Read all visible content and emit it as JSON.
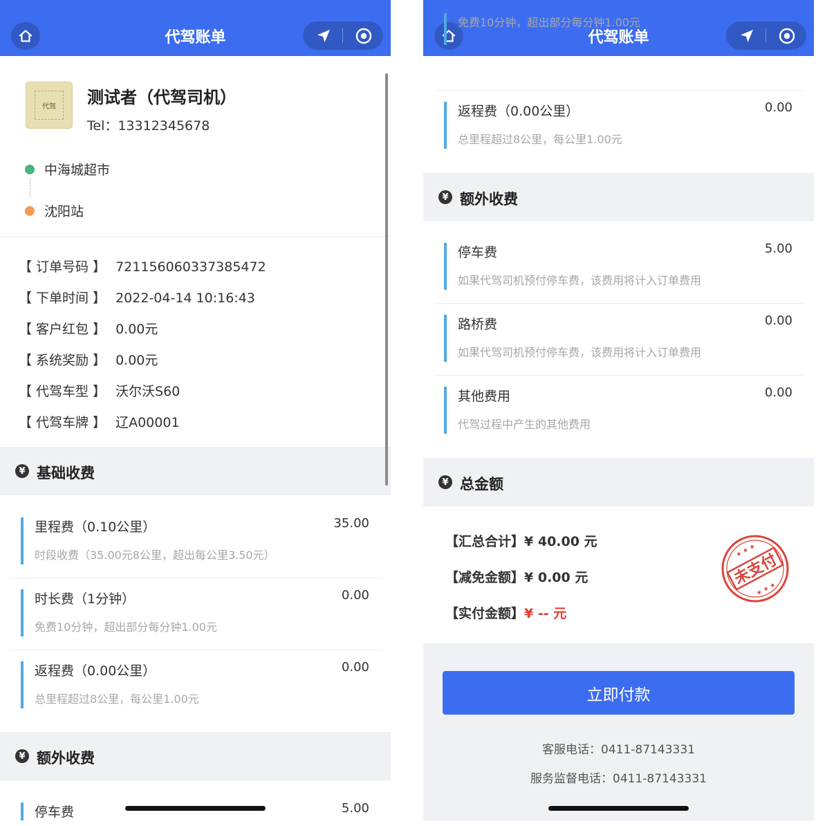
{
  "navbar": {
    "title": "代驾账单"
  },
  "driver": {
    "name": "测试者（代驾司机）",
    "tel": "Tel：13312345678",
    "avatar_text": "代驾",
    "start": "中海城超市",
    "end": "沈阳站",
    "start_color": "#49b47e",
    "end_color": "#f59b52"
  },
  "order": [
    {
      "label": "【 订单号码 】",
      "value": "721156060337385472"
    },
    {
      "label": "【 下单时间 】",
      "value": "2022-04-14 10:16:43"
    },
    {
      "label": "【 客户红包 】",
      "value": "0.00元"
    },
    {
      "label": "【 系统奖励 】",
      "value": "0.00元"
    },
    {
      "label": "【 代驾车型 】",
      "value": "沃尔沃S60"
    },
    {
      "label": "【 代驾车牌 】",
      "value": "辽A00001"
    }
  ],
  "sections": {
    "base": "基础收费",
    "extra": "额外收费",
    "total": "总金额"
  },
  "base_fees": [
    {
      "name": "里程费（0.10公里）",
      "desc": "时段收费（35.00元8公里，超出每公里3.50元）",
      "amount": "35.00"
    },
    {
      "name": "时长费（1分钟）",
      "desc": "免费10分钟，超出部分每分钟1.00元",
      "amount": "0.00"
    },
    {
      "name": "返程费（0.00公里）",
      "desc": "总里程超过8公里，每公里1.00元",
      "amount": "0.00"
    }
  ],
  "extra_fees": [
    {
      "name": "停车费",
      "desc": "如果代驾司机预付停车费，该费用将计入订单费用",
      "amount": "5.00"
    },
    {
      "name": "路桥费",
      "desc": "如果代驾司机预付停车费，该费用将计入订单费用",
      "amount": "0.00"
    },
    {
      "name": "其他费用",
      "desc": "代驾过程中产生的其他费用",
      "amount": "0.00"
    }
  ],
  "summary": {
    "total_label": "【汇总合计】",
    "total_value": "¥ 40.00 元",
    "discount_label": "【减免金额】",
    "discount_value": "¥ 0.00 元",
    "paid_label": "【实付金额】",
    "paid_value": "¥ -- 元",
    "stamp_text": "未支付"
  },
  "pay_button": "立即付款",
  "contact": {
    "service": "客服电话：0411-87143331",
    "supervise": "服务监督电话：0411-87143331"
  },
  "colors": {
    "primary": "#3c6df0",
    "accent_bar": "#51a8e3",
    "paid_red": "#e23b2e",
    "stamp_red": "#d9443a"
  }
}
